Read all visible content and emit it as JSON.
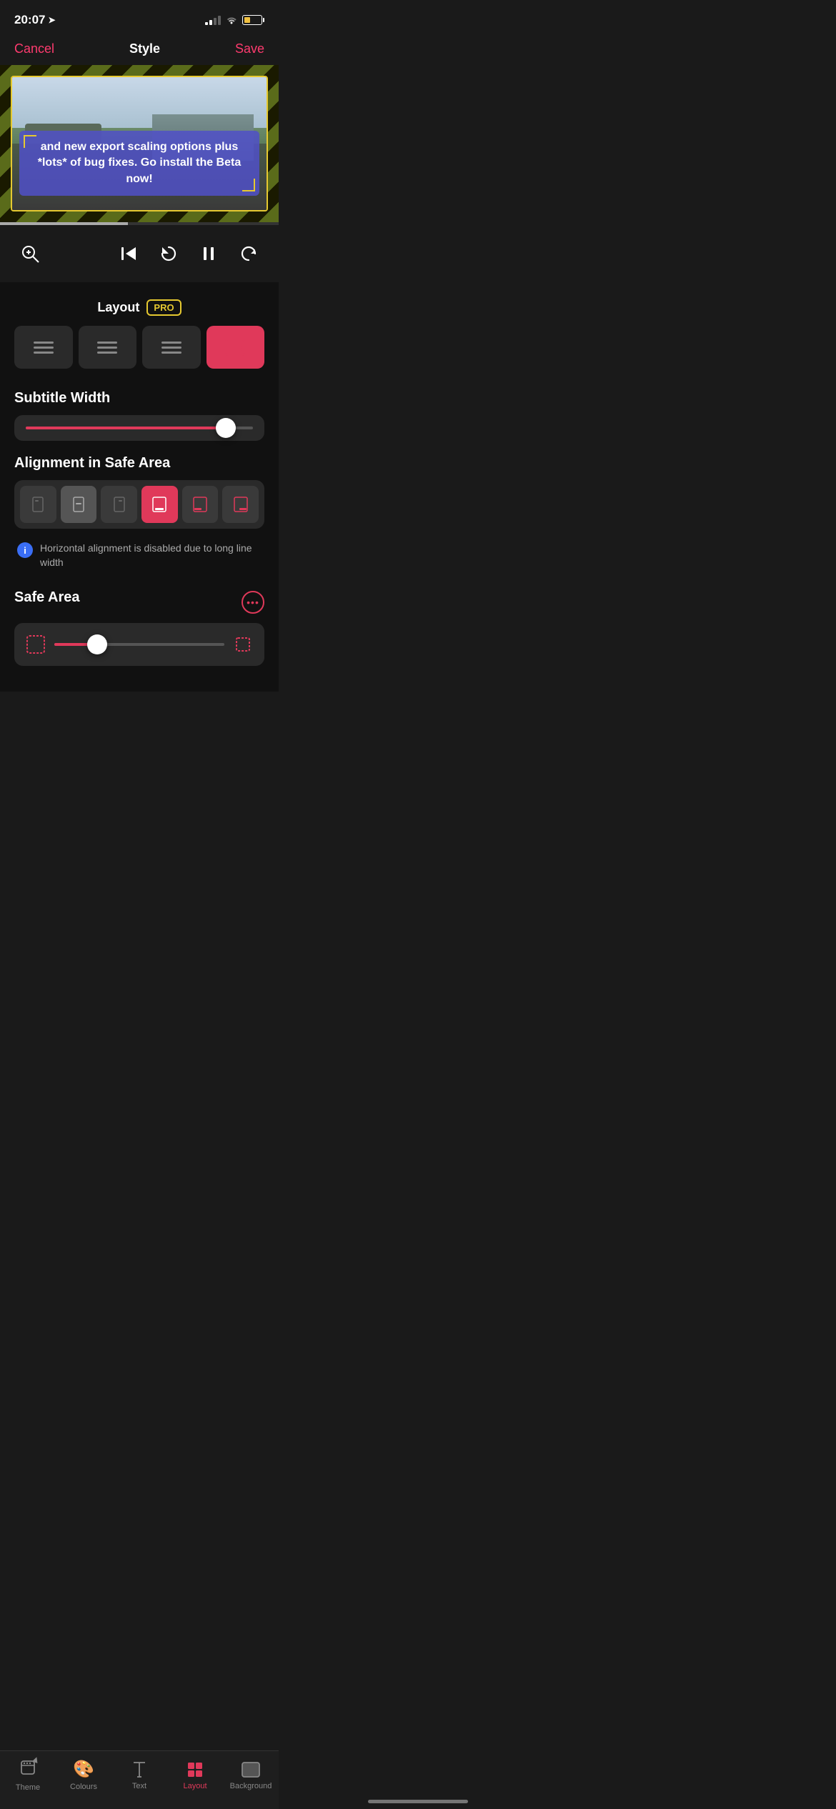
{
  "statusBar": {
    "time": "20:07",
    "locationArrow": "➤"
  },
  "navBar": {
    "cancel": "Cancel",
    "title": "Style",
    "save": "Save"
  },
  "videoPreview": {
    "subtitleText": "and new export scaling options plus *lots* of bug fixes. Go install the Beta now!"
  },
  "layout": {
    "title": "Layout",
    "proBadge": "PRO"
  },
  "subtitleWidth": {
    "label": "Subtitle Width",
    "fillPercent": 88
  },
  "alignmentSafeArea": {
    "label": "Alignment in Safe Area",
    "infoText": "Horizontal alignment is disabled due to long line width"
  },
  "safeArea": {
    "label": "Safe Area",
    "moreIcon": "···"
  },
  "tabBar": {
    "items": [
      {
        "id": "theme",
        "label": "Theme",
        "icon": "✦"
      },
      {
        "id": "colours",
        "label": "Colours",
        "icon": "🎨"
      },
      {
        "id": "text",
        "label": "Text",
        "icon": "T"
      },
      {
        "id": "layout",
        "label": "Layout",
        "icon": "⊞",
        "active": true
      },
      {
        "id": "background",
        "label": "Background",
        "icon": "▭"
      }
    ]
  }
}
